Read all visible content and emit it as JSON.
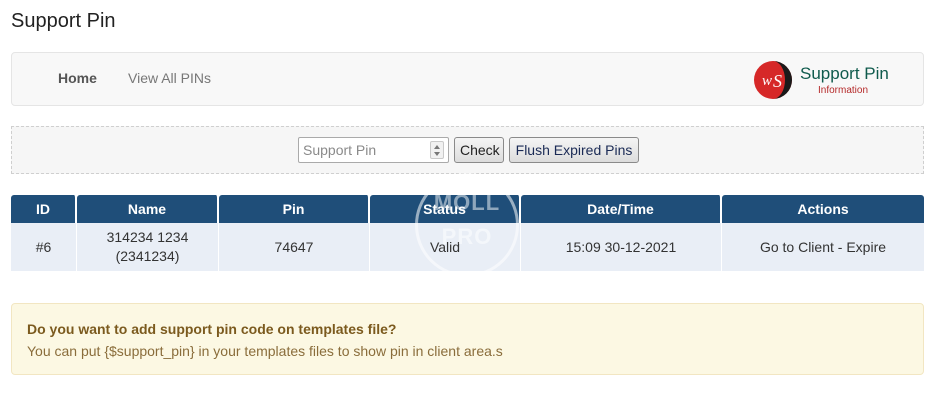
{
  "page": {
    "title": "Support Pin"
  },
  "nav": {
    "home_label": "Home",
    "view_all_label": "View All PINs"
  },
  "brand": {
    "title": "Support Pin",
    "subtitle": "Information",
    "logo_letters": "WS"
  },
  "form": {
    "pin_placeholder": "Support Pin",
    "check_label": "Check",
    "flush_label": "Flush Expired Pins"
  },
  "table": {
    "headers": [
      "ID",
      "Name",
      "Pin",
      "Status",
      "Date/Time",
      "Actions"
    ],
    "rows": [
      {
        "id": "#6",
        "name_line1": "314234 1234",
        "name_line2": "(2341234)",
        "pin": "74647",
        "status": "Valid",
        "datetime": "15:09 30-12-2021",
        "action_client": "Go to Client",
        "action_separator": " - ",
        "action_expire": "Expire"
      }
    ]
  },
  "watermark": {
    "line1": "MOLL",
    "line2": "PRO"
  },
  "alert": {
    "title": "Do you want to add support pin code on templates file?",
    "text": "You can put {$support_pin} in your templates files to show pin in client area.s"
  },
  "colors": {
    "header_bg": "#1f4e79",
    "row_bg": "#e9eef6",
    "alert_bg": "#fcf8e3",
    "brand_green": "#0f5a4c",
    "brand_red": "#b52a2a"
  }
}
